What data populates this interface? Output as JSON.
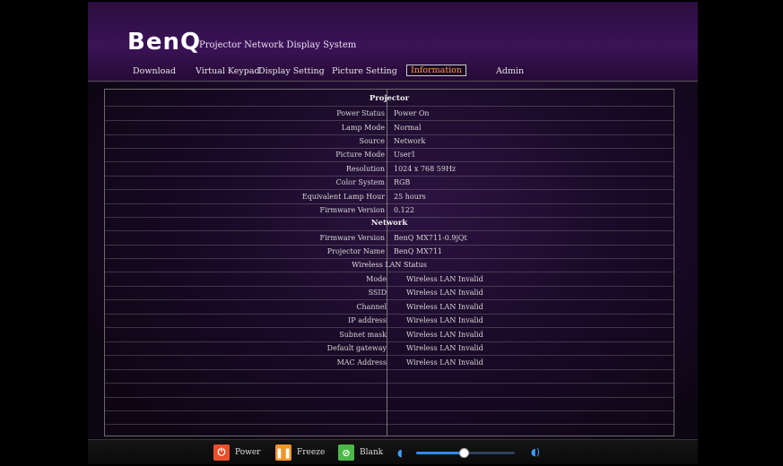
{
  "header": {
    "logo": "BenQ",
    "subtitle": "Projector Network Display System"
  },
  "nav": {
    "items": [
      {
        "label": "Download"
      },
      {
        "label": "Virtual Keypad"
      },
      {
        "label": "Display Setting"
      },
      {
        "label": "Picture Setting"
      },
      {
        "label": "Information",
        "active": true
      },
      {
        "label": "Admin"
      }
    ]
  },
  "projector": {
    "title": "Projector",
    "rows": [
      {
        "label": "Power Status",
        "value": "Power On"
      },
      {
        "label": "Lamp Mode",
        "value": "Normal"
      },
      {
        "label": "Source",
        "value": "Network"
      },
      {
        "label": "Picture Mode",
        "value": "User1"
      },
      {
        "label": "Resolution",
        "value": "1024 x 768 59Hz"
      },
      {
        "label": "Color System",
        "value": "RGB"
      },
      {
        "label": "Equivalent Lamp Hour",
        "value": "25 hours"
      },
      {
        "label": "Firmware Version",
        "value": "0.122"
      }
    ]
  },
  "network": {
    "title": "Network",
    "rows": [
      {
        "label": "Firmware Version",
        "value": "BenQ MX711-0.9jQt"
      },
      {
        "label": "Projector Name",
        "value": "BenQ MX711"
      }
    ],
    "wireless_title": "Wireless LAN Status",
    "wireless_rows": [
      {
        "label": "Mode",
        "value": "Wireless LAN Invalid"
      },
      {
        "label": "SSID",
        "value": "Wireless LAN Invalid"
      },
      {
        "label": "Channel",
        "value": "Wireless LAN Invalid"
      },
      {
        "label": "IP address",
        "value": "Wireless LAN Invalid"
      },
      {
        "label": "Subnet mask",
        "value": "Wireless LAN Invalid"
      },
      {
        "label": "Default gateway",
        "value": "Wireless LAN Invalid"
      },
      {
        "label": "MAC Address",
        "value": "Wireless LAN Invalid"
      }
    ]
  },
  "controls": {
    "power": {
      "label": "Power",
      "icon": "power-icon",
      "color": "#e8502a"
    },
    "freeze": {
      "label": "Freeze",
      "icon": "pause-icon",
      "color": "#f2962a"
    },
    "blank": {
      "label": "Blank",
      "icon": "blank-icon",
      "color": "#4cb848"
    },
    "volume": {
      "level": 0.48,
      "accent": "#2e8cf0"
    }
  }
}
